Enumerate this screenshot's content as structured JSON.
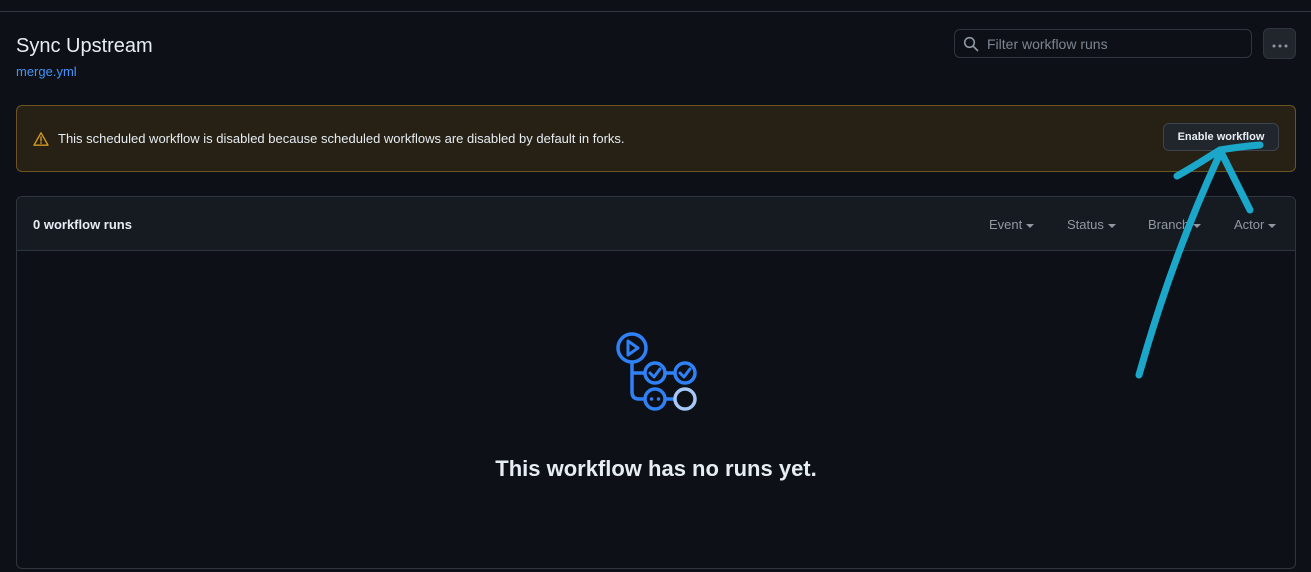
{
  "header": {
    "title": "Sync Upstream",
    "file_link": "merge.yml"
  },
  "filter": {
    "placeholder": "Filter workflow runs",
    "value": ""
  },
  "banner": {
    "message": "This scheduled workflow is disabled because scheduled workflows are disabled by default in forks.",
    "button_label": "Enable workflow"
  },
  "runs": {
    "count_label": "0 workflow runs",
    "filters": [
      "Event",
      "Status",
      "Branch",
      "Actor"
    ],
    "empty_message": "This workflow has no runs yet."
  },
  "icons": {
    "search": "search-icon",
    "more": "kebab-horizontal-icon",
    "alert": "alert-triangle-icon",
    "empty": "workflow-icon"
  },
  "colors": {
    "background": "#0d1117",
    "link": "#4493f8",
    "warning": "#d29922",
    "annotation": "#1aa7c9"
  }
}
